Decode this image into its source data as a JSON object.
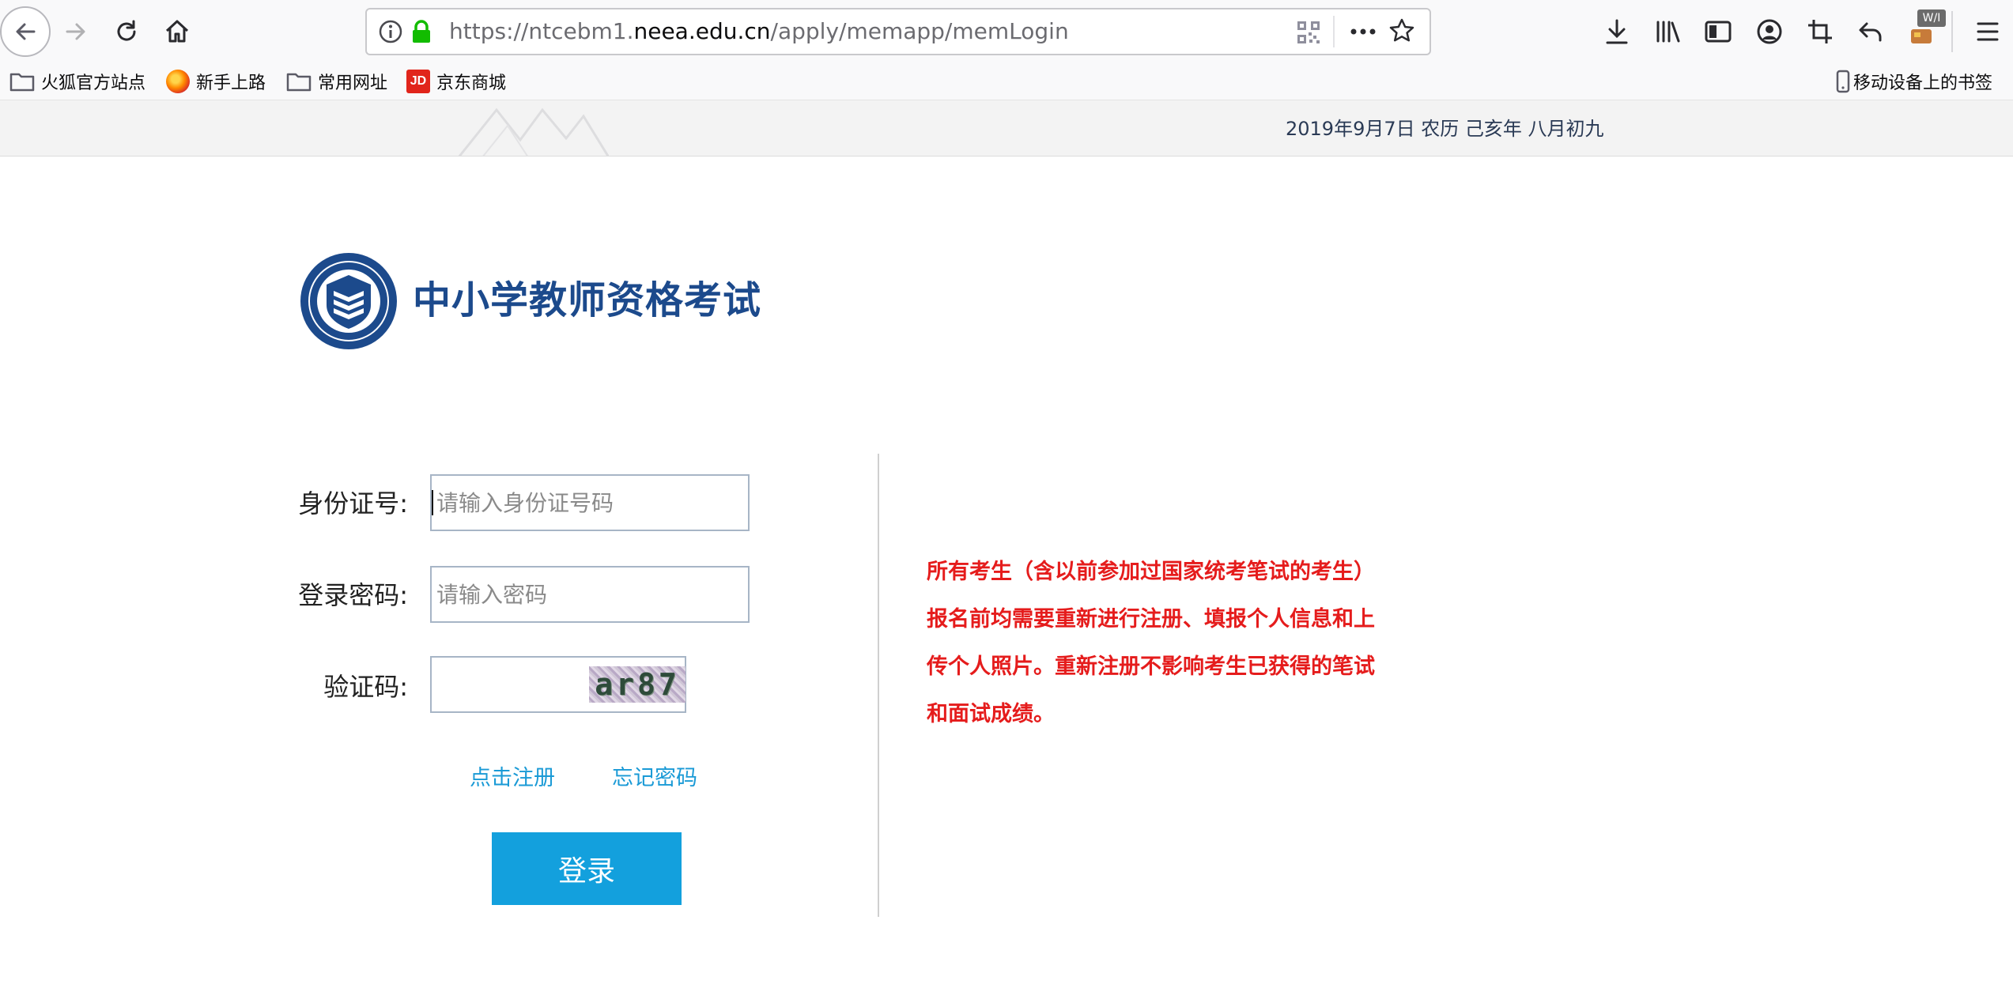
{
  "browser": {
    "url_prefix": "https://ntcebm1.",
    "url_domain": "neea.edu.cn",
    "url_path": "/apply/memapp/memLogin",
    "badge": "W/I"
  },
  "bookmarks": {
    "items": [
      {
        "label": "火狐官方站点",
        "icon": "folder-icon"
      },
      {
        "label": "新手上路",
        "icon": "firefox-icon"
      },
      {
        "label": "常用网址",
        "icon": "folder-icon"
      },
      {
        "label": "京东商城",
        "icon": "jd-icon",
        "icon_text": "JD"
      }
    ],
    "mobile": "移动设备上的书签"
  },
  "header": {
    "date": "2019年9月7日 农历 己亥年 八月初九"
  },
  "logo": {
    "title": "中小学教师资格考试"
  },
  "form": {
    "id_label": "身份证号:",
    "id_placeholder": "请输入身份证号码",
    "pwd_label": "登录密码:",
    "pwd_placeholder": "请输入密码",
    "captcha_label": "验证码:",
    "captcha_text": "ar87",
    "register_link": "点击注册",
    "forgot_link": "忘记密码",
    "login_button": "登录"
  },
  "notice": {
    "text": "所有考生（含以前参加过国家统考笔试的考生）报名前均需要重新进行注册、填报个人信息和上传个人照片。重新注册不影响考生已获得的笔试和面试成绩。"
  },
  "colors": {
    "accent": "#13a0dd",
    "link": "#1a9ad6",
    "notice": "#e51c1c",
    "logo_blue": "#1c4a8c"
  }
}
